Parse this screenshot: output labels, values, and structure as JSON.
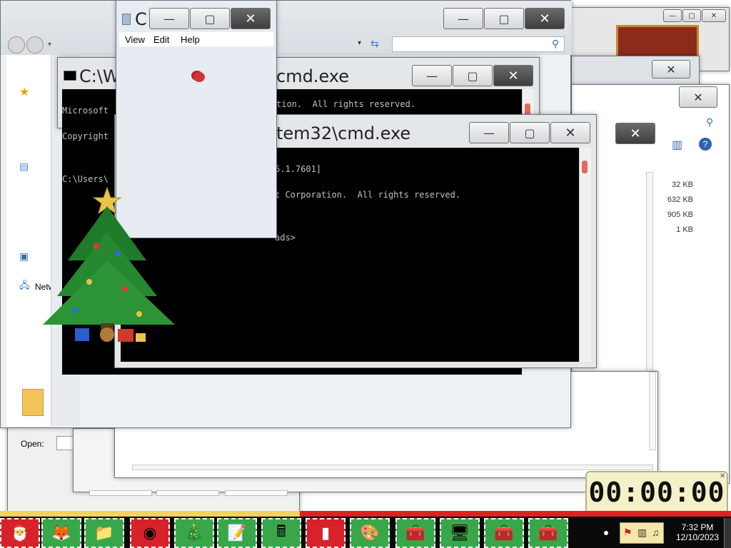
{
  "explorer": {
    "nav_item_network": "Netw",
    "open_label": "Open:",
    "sizes": [
      "32 KB",
      "632 KB",
      "905 KB",
      "1 KB"
    ]
  },
  "calculator": {
    "title": "C",
    "menu": [
      "View",
      "Edit",
      "Help"
    ]
  },
  "cmd_back": {
    "title_left": "C:\\W",
    "title_right": "cmd.exe",
    "lines": [
      "Microsoft",
      "Copyright",
      "",
      "C:\\Users\\"
    ],
    "line_tail": "tion.  All rights reserved."
  },
  "cmd_front": {
    "title": "tem32\\cmd.exe",
    "lines": [
      "6.1.7601]",
      "t Corporation.  All rights reserved.",
      "",
      "ads>"
    ]
  },
  "window_controls": {
    "minimize": "—",
    "maximize": "▢",
    "close": "✕"
  },
  "timer": {
    "display": "00:00:00"
  },
  "taskbar": {
    "clock_time": "7:32 PM",
    "clock_date": "12/10/2023",
    "buttons": [
      {
        "name": "start-santa",
        "icon": "santa-icon",
        "glyph": "🎅"
      },
      {
        "name": "firefox",
        "icon": "firefox-icon",
        "glyph": "🦊"
      },
      {
        "name": "explorer",
        "icon": "folder-icon",
        "glyph": "📁"
      },
      {
        "name": "chrome",
        "icon": "chrome-icon",
        "glyph": "◉"
      },
      {
        "name": "xmas-tree",
        "icon": "tree-icon",
        "glyph": "🎄"
      },
      {
        "name": "notepad",
        "icon": "notepad-icon",
        "glyph": "📝"
      },
      {
        "name": "calculator",
        "icon": "calculator-icon",
        "glyph": "🖩"
      },
      {
        "name": "cmd",
        "icon": "cmd-icon",
        "glyph": "▮"
      },
      {
        "name": "paint",
        "icon": "paint-icon",
        "glyph": "🎨"
      },
      {
        "name": "toolbox-1",
        "icon": "toolbox-icon",
        "glyph": "🧰"
      },
      {
        "name": "control-panel",
        "icon": "control-panel-icon",
        "glyph": "🖥"
      },
      {
        "name": "toolbox-2",
        "icon": "toolbox-icon",
        "glyph": "🧰"
      },
      {
        "name": "toolbox-3",
        "icon": "toolbox-icon",
        "glyph": "🧰"
      }
    ]
  }
}
